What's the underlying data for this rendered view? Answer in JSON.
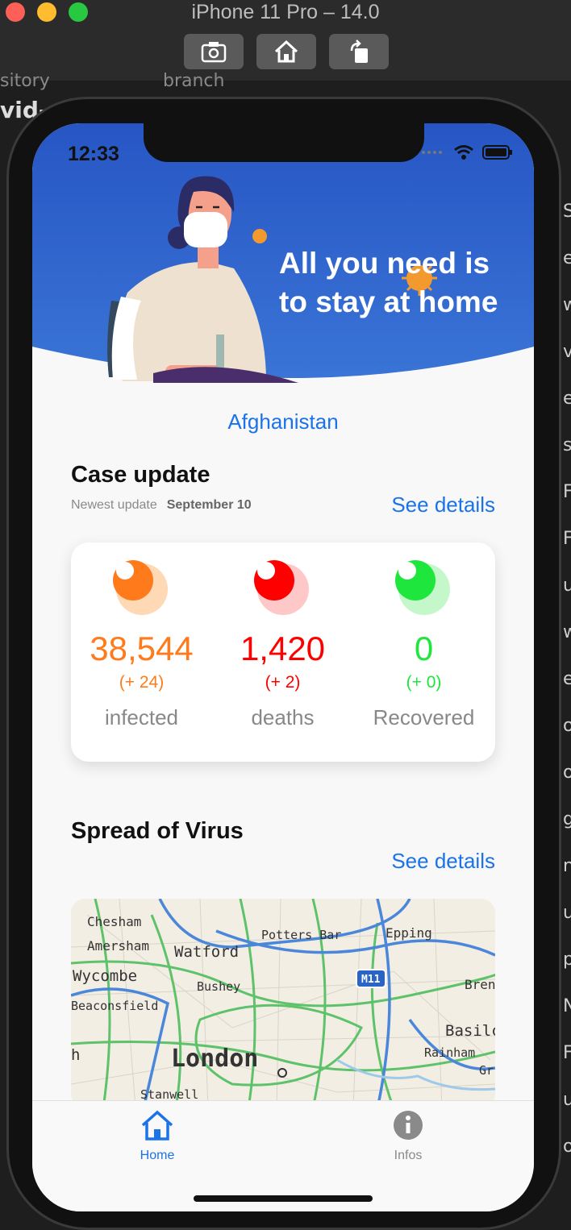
{
  "simulator": {
    "title": "iPhone 11 Pro – 14.0",
    "buttons": [
      "screenshot-icon",
      "home-icon",
      "rotate-icon"
    ]
  },
  "background": {
    "left_texts": [
      "sitory",
      "branch",
      "vid-"
    ],
    "right_letters": [
      "S",
      "e",
      "w",
      "v",
      "e",
      "s",
      "F",
      "F",
      "u",
      "w",
      "e",
      "o",
      "o",
      "g",
      "n",
      "u",
      "p",
      "N",
      "F",
      "u",
      "o"
    ]
  },
  "status_bar": {
    "time": "12:33"
  },
  "header": {
    "headline": "All you need is to stay at home"
  },
  "country": "Afghanistan",
  "case_update": {
    "title": "Case update",
    "newest_label": "Newest update",
    "date": "September 10",
    "see_details": "See details",
    "stats": [
      {
        "number": "38,544",
        "delta": "(+ 24)",
        "label": "infected",
        "color": "#ff7a1a",
        "light": "#ffd9b5"
      },
      {
        "number": "1,420",
        "delta": "(+ 2)",
        "label": "deaths",
        "color": "#ff0000",
        "light": "#ffc8c8"
      },
      {
        "number": "0",
        "delta": "(+ 0)",
        "label": "Recovered",
        "color": "#1ee63c",
        "light": "#c4f7c9"
      }
    ]
  },
  "spread": {
    "title": "Spread of Virus",
    "see_details": "See details",
    "map_labels": [
      "Chesham",
      "Amersham",
      "Watford",
      "Potters Bar",
      "Epping",
      "Wycombe",
      "Bushey",
      "M11",
      "Bren",
      "Beaconsfield",
      "Basilc",
      "h",
      "London",
      "Rainham",
      "Gr",
      "Stanwell"
    ]
  },
  "tabs": [
    {
      "label": "Home",
      "icon": "home-icon",
      "active": true
    },
    {
      "label": "Infos",
      "icon": "info-icon",
      "active": false
    }
  ],
  "colors": {
    "accent": "#1a73e8",
    "header_blue": "#2a5cc4"
  }
}
